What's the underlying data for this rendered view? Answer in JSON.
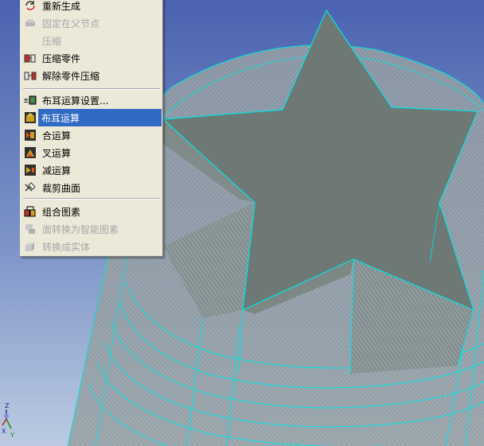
{
  "context_menu": {
    "items": [
      {
        "label": "重新生成",
        "icon": "regenerate-icon",
        "enabled": true
      },
      {
        "label": "固定在父节点",
        "icon": "pin-to-parent-icon",
        "enabled": false
      },
      {
        "label": "压缩",
        "icon": "",
        "enabled": false
      },
      {
        "label": "压缩零件",
        "icon": "compress-part-icon",
        "enabled": true
      },
      {
        "label": "解除零件压缩",
        "icon": "uncompress-part-icon",
        "enabled": true
      },
      {
        "label": "布耳运算设置...",
        "icon": "boolean-settings-icon",
        "enabled": true
      },
      {
        "label": "布耳运算",
        "icon": "boolean-icon",
        "enabled": true,
        "selected": true
      },
      {
        "label": "合运算",
        "icon": "union-icon",
        "enabled": true
      },
      {
        "label": "叉运算",
        "icon": "intersect-icon",
        "enabled": true
      },
      {
        "label": "减运算",
        "icon": "subtract-icon",
        "enabled": true
      },
      {
        "label": "裁剪曲面",
        "icon": "trim-surface-icon",
        "enabled": true
      },
      {
        "label": "组合图素",
        "icon": "group-elements-icon",
        "enabled": true
      },
      {
        "label": "面转换为智能图素",
        "icon": "face-to-smart-icon",
        "enabled": false
      },
      {
        "label": "转换成实体",
        "icon": "convert-solid-icon",
        "enabled": false
      }
    ]
  },
  "axis_triad": {
    "z": "Z",
    "x": "X",
    "y": "Y"
  },
  "colors": {
    "menu_bg": "#ece9d8",
    "selection": "#316ac5",
    "disabled_text": "#a7a6aa",
    "wireframe": "#00e5e5",
    "star_face": "#6e7875",
    "background_top": "#506ab4",
    "background_bottom": "#b8c8e0"
  }
}
